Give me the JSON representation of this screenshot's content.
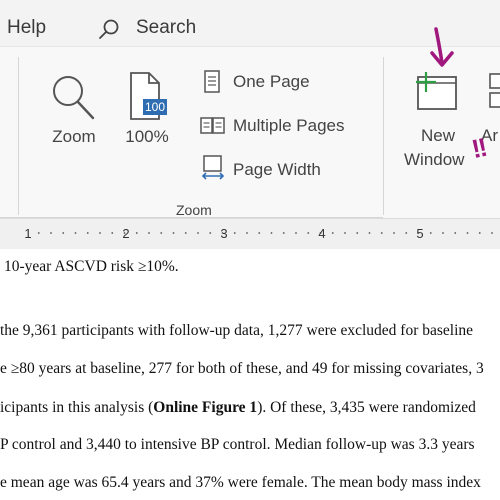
{
  "menubar": {
    "help_label": "Help",
    "search_label": "Search"
  },
  "ribbon": {
    "zoom_button": {
      "label": "Zoom",
      "icon": "magnifier-icon"
    },
    "hundred_percent_button": {
      "label": "100%",
      "icon_text": "100"
    },
    "one_page_label": "One Page",
    "multiple_pages_label": "Multiple Pages",
    "page_width_label": "Page Width",
    "group_label": "Zoom",
    "new_window": {
      "line1": "New",
      "line2": "Window"
    },
    "arrange_partial_label": "Ar",
    "annotation_marks": "!!"
  },
  "ruler": {
    "numbers": [
      "1",
      "2",
      "3",
      "4",
      "5"
    ]
  },
  "document": {
    "lines": [
      {
        "text": "10-year ASCVD risk ≥10%."
      },
      {
        "text": "the 9,361 participants with follow-up data, 1,277 were excluded for baseline"
      },
      {
        "text": "e ≥80 years at baseline, 277 for both of these, and 49 for missing covariates, 3"
      },
      {
        "pre": "icipants in this analysis (",
        "bold": "Online Figure 1",
        "post": "). Of these, 3,435 were randomized"
      },
      {
        "text": "P control and 3,440 to intensive BP control. Median follow-up was 3.3 years"
      },
      {
        "text": "e mean age was 65.4 years and 37% were female. The mean body mass index"
      }
    ]
  },
  "colors": {
    "accent_green": "#2e9e44",
    "annotation_purple": "#a0177d",
    "icon_blue": "#2f6db3"
  }
}
